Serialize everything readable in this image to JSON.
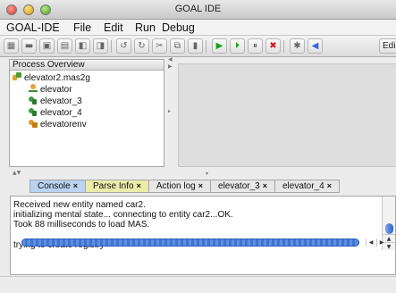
{
  "window": {
    "title": "GOAL IDE"
  },
  "menubar": {
    "items": [
      "GOAL-IDE",
      "File",
      "Edit",
      "Run",
      "Debug"
    ]
  },
  "toolbar": {
    "edit_label": "Edi"
  },
  "process_overview": {
    "title": "Process Overview",
    "items": [
      {
        "label": "elevator2.mas2g",
        "icon": "mas-project-icon"
      },
      {
        "label": "elevator",
        "icon": "agent-person-icon"
      },
      {
        "label": "elevator_3",
        "icon": "agent-icon"
      },
      {
        "label": "elevator_4",
        "icon": "agent-icon"
      },
      {
        "label": "elevatorenv",
        "icon": "environment-icon"
      }
    ]
  },
  "tabs": [
    {
      "label": "Console",
      "close": "×",
      "active": true
    },
    {
      "label": "Parse Info",
      "close": "×"
    },
    {
      "label": "Action log",
      "close": "×"
    },
    {
      "label": "elevator_3",
      "close": "×"
    },
    {
      "label": "elevator_4",
      "close": "×"
    }
  ],
  "console": {
    "lines": [
      "Received new entity named car2.",
      "initializing mental state... connecting to entity car2...OK.",
      "Took 88 milliseconds to load MAS.",
      "",
      "trying to create registry"
    ]
  },
  "colors": {
    "active_tab": "#b9d3f0",
    "parse_tab": "#ecebaa",
    "scroll_thumb": "#3e74d2"
  }
}
